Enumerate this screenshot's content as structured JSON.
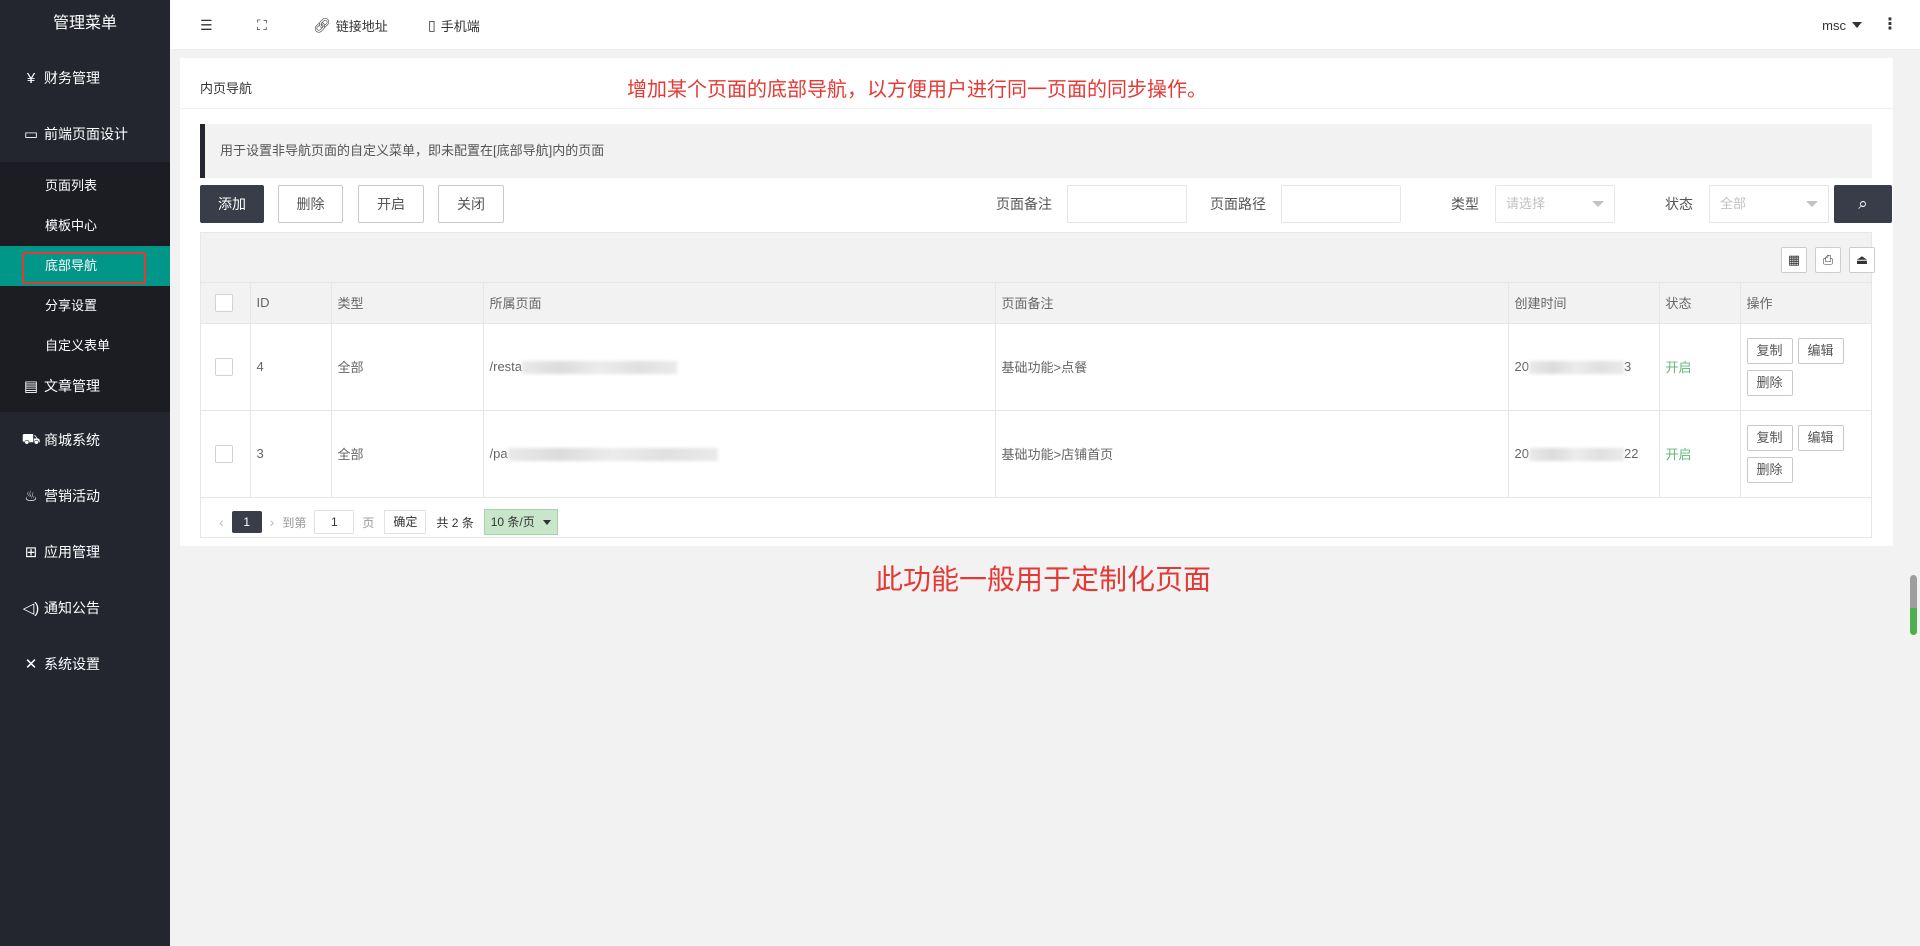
{
  "sidebar": {
    "title": "管理菜单",
    "items": [
      {
        "label": "财务管理",
        "icon": "yen-icon"
      },
      {
        "label": "前端页面设计",
        "icon": "layout-icon"
      },
      {
        "label": "文章管理",
        "icon": "document-icon"
      },
      {
        "label": "商城系统",
        "icon": "cart-icon"
      },
      {
        "label": "营销活动",
        "icon": "fire-icon"
      },
      {
        "label": "应用管理",
        "icon": "apps-icon"
      },
      {
        "label": "通知公告",
        "icon": "speaker-icon"
      },
      {
        "label": "系统设置",
        "icon": "tools-icon"
      }
    ],
    "submenu": [
      "页面列表",
      "模板中心",
      "底部导航",
      "分享设置",
      "自定义表单"
    ]
  },
  "topbar": {
    "link_label": "链接地址",
    "mobile_label": "手机端",
    "user": "msc"
  },
  "page": {
    "title": "内页导航",
    "note_top": "增加某个页面的底部导航，以方便用户进行同一页面的同步操作。",
    "tip": "用于设置非导航页面的自定义菜单，即未配置在[底部导航]内的页面",
    "note_bottom": "此功能一般用于定制化页面"
  },
  "actions": {
    "add": "添加",
    "delete": "删除",
    "enable": "开启",
    "disable": "关闭"
  },
  "filters": {
    "remark_label": "页面备注",
    "path_label": "页面路径",
    "type_label": "类型",
    "type_placeholder": "请选择",
    "status_label": "状态",
    "status_value": "全部"
  },
  "table": {
    "headers": [
      "ID",
      "类型",
      "所属页面",
      "页面备注",
      "创建时间",
      "状态",
      "操作"
    ],
    "rows": [
      {
        "id": "4",
        "type": "全部",
        "page_prefix": "/resta",
        "page_suffix": "",
        "remark": "基础功能>点餐",
        "created_prefix": "20",
        "created_suffix": "3",
        "status": "开启"
      },
      {
        "id": "3",
        "type": "全部",
        "page_prefix": "/pa",
        "page_suffix": "",
        "remark": "基础功能>店铺首页",
        "created_prefix": "20",
        "created_suffix": "22",
        "status": "开启"
      }
    ],
    "ops": {
      "copy": "复制",
      "edit": "编辑",
      "delete": "删除"
    }
  },
  "pager": {
    "current": "1",
    "goto_label": "到第",
    "page_input": "1",
    "page_unit": "页",
    "confirm": "确定",
    "total": "共 2 条",
    "limit": "10 条/页"
  },
  "colors": {
    "sidebar_bg": "#23262e",
    "active": "#009688",
    "annotation": "#e53935",
    "status_on": "#5fb878"
  }
}
